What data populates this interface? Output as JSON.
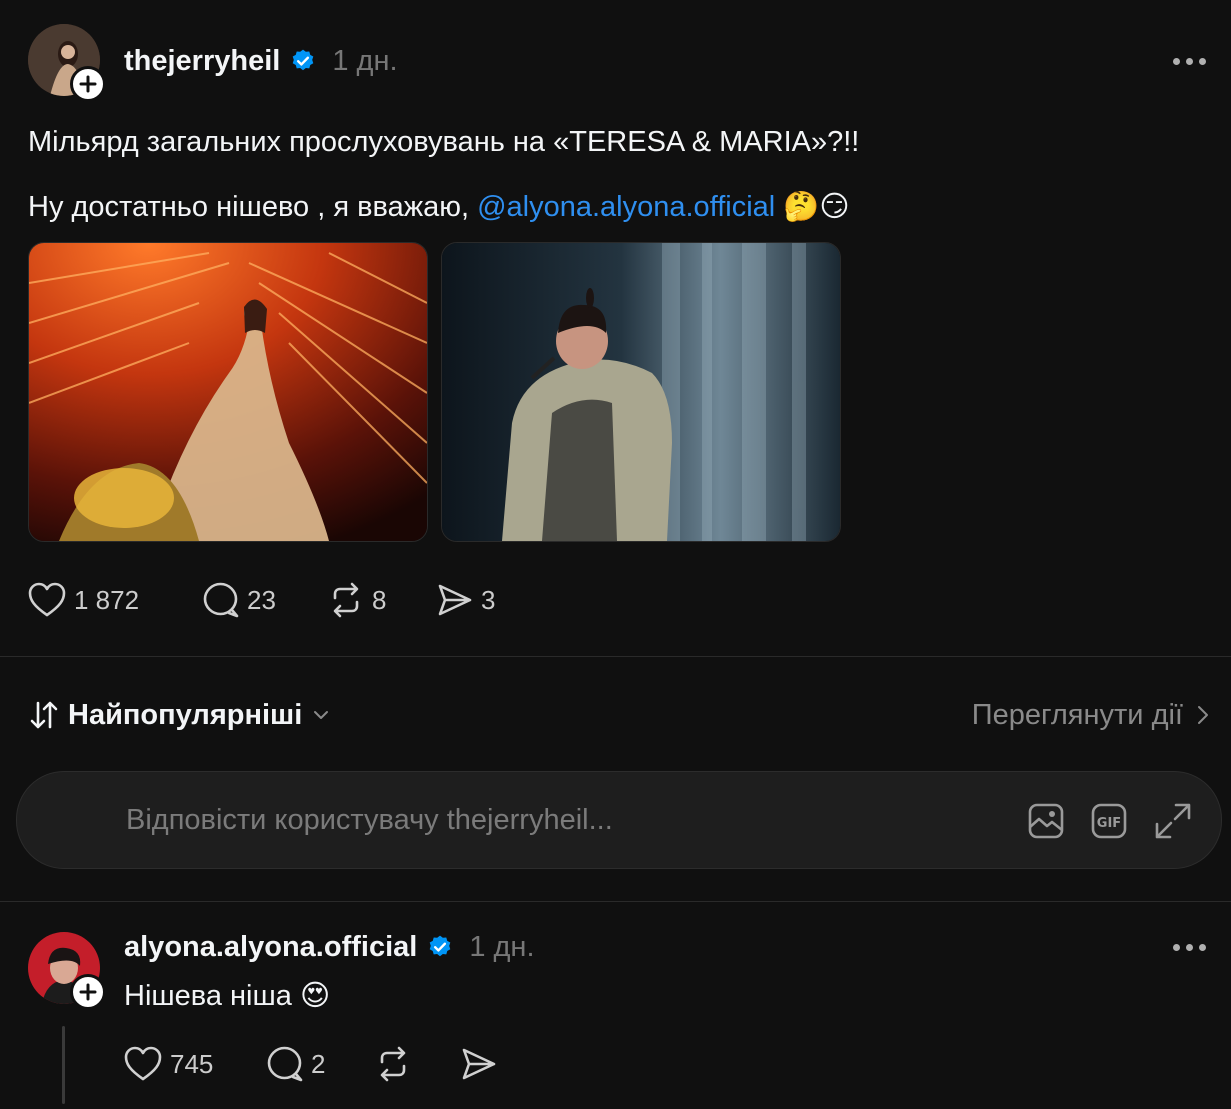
{
  "post": {
    "username": "thejerryheil",
    "time": "1 дн.",
    "text_line1": "Мільярд загальних прослуховувань на «TERESA & MARIA»?!!",
    "text_line2_prefix": "Ну достатньо нішево , я вважаю, ",
    "mention": "@alyona.alyona.official",
    "emojis": "🤔😏",
    "stats": {
      "likes": "1 872",
      "comments": "23",
      "reposts": "8",
      "shares": "3"
    }
  },
  "sort": {
    "label": "Найпопулярніші",
    "view_activity": "Переглянути дії"
  },
  "reply_box": {
    "placeholder": "Відповісти користувачу thejerryheil..."
  },
  "reply": {
    "username": "alyona.alyona.official",
    "time": "1 дн.",
    "text": "Нішева ніша",
    "emoji": "😍",
    "stats": {
      "likes": "745",
      "comments": "2"
    }
  },
  "colors": {
    "background": "#101010",
    "accent_blue": "#2f8ff0",
    "verified_badge": "#0095f6"
  }
}
